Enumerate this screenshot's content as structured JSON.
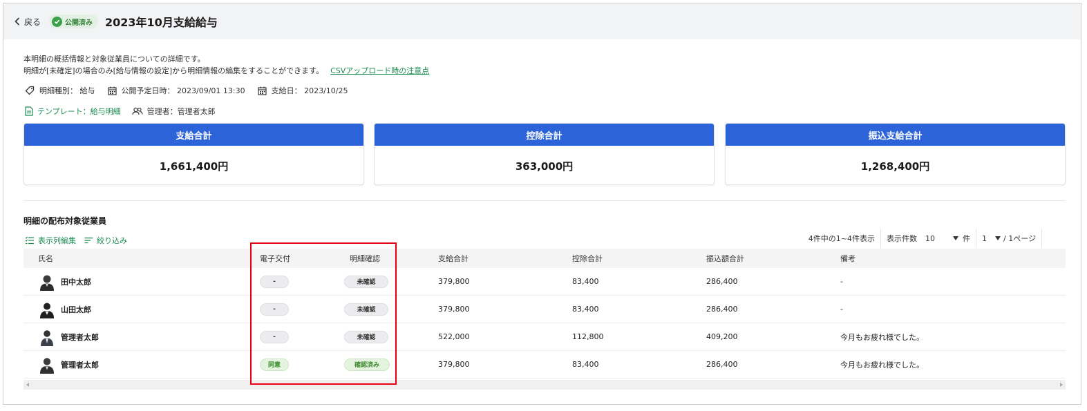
{
  "header": {
    "back_label": "戻る",
    "status_badge": "公開済み",
    "title": "2023年10月支給給与"
  },
  "description": {
    "line1": "本明細の概括情報と対象従業員についての詳細です。",
    "line2": "明細が[未確定]の場合のみ[給与情報の設定]から明細情報の編集をすることができます。",
    "csv_link": "CSVアップロード時の注意点"
  },
  "meta": {
    "type": "明細種別： 給与",
    "publish_date": "公開予定日時： 2023/09/01 13:30",
    "pay_date": "支給日： 2023/10/25",
    "template": "テンプレート：給与明細",
    "manager": "管理者：管理者太郎"
  },
  "summary": [
    {
      "label": "支給合計",
      "value": "1,661,400円"
    },
    {
      "label": "控除合計",
      "value": "363,000円"
    },
    {
      "label": "振込支給合計",
      "value": "1,268,400円"
    }
  ],
  "section": {
    "title": "明細の配布対象従業員",
    "edit_columns": "表示列編集",
    "filter": "絞り込み"
  },
  "pager": {
    "count_text": "4件中の1~4件表示",
    "per_page_label": "表示件数",
    "per_page_value": "10",
    "per_page_unit": "件",
    "page_value": "1",
    "page_total": "/ 1ページ"
  },
  "table": {
    "headers": [
      "氏名",
      "電子交付",
      "明細確認",
      "支給合計",
      "控除合計",
      "振込額合計",
      "備考"
    ],
    "rows": [
      {
        "name": "田中太郎",
        "efile": "-",
        "confirm": "未確認",
        "pay": "379,800",
        "deduct": "83,400",
        "transfer": "286,400",
        "note": "-"
      },
      {
        "name": "山田太郎",
        "efile": "-",
        "confirm": "未確認",
        "pay": "379,800",
        "deduct": "83,400",
        "transfer": "286,400",
        "note": "-"
      },
      {
        "name": "管理者太郎",
        "efile": "-",
        "confirm": "未確認",
        "pay": "522,000",
        "deduct": "112,800",
        "transfer": "409,200",
        "note": "今月もお疲れ様でした。"
      },
      {
        "name": "管理者太郎",
        "efile": "同意",
        "confirm": "確認済み",
        "pay": "379,800",
        "deduct": "83,400",
        "transfer": "286,400",
        "note": "今月もお疲れ様でした。"
      }
    ]
  },
  "colors": {
    "accent_blue": "#2c63d8",
    "link_green": "#1a8a50",
    "highlight_red": "#e60012"
  }
}
